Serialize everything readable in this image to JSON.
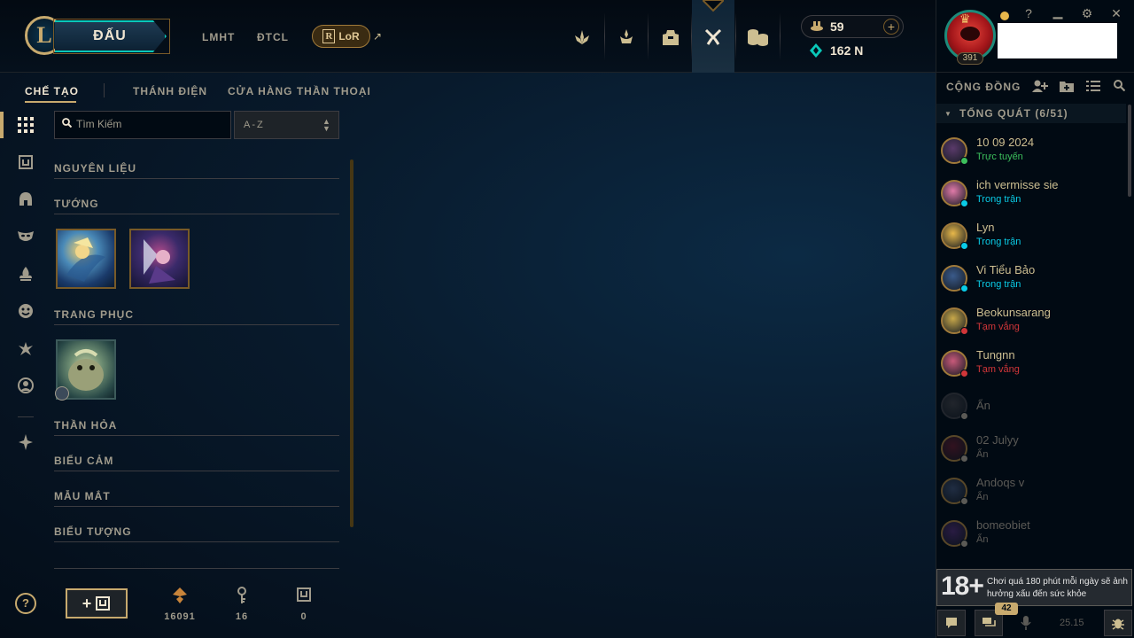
{
  "header": {
    "logo": "L",
    "play_label": "ĐẤU",
    "links": [
      "LMHT",
      "ĐTCL"
    ],
    "lor_label": "LoR",
    "lor_glyph": "R",
    "external_glyph": "↗",
    "nav_icons": [
      "home-icon",
      "tft-icon",
      "collection-icon",
      "loot-icon",
      "store-icon"
    ]
  },
  "currency": {
    "rp": "59",
    "blue_essence": "162 N",
    "add": "+"
  },
  "profile": {
    "level": "391"
  },
  "subnav": {
    "tabs": [
      "CHẾ TẠO",
      "THÁNH ĐIỆN",
      "CỬA HÀNG THẦN THOẠI"
    ]
  },
  "search": {
    "placeholder": "Tìm Kiếm",
    "sort_value": "A-Z"
  },
  "categories": [
    "NGUYÊN LIỆU",
    "TƯỚNG",
    "TRANG PHỤC",
    "THẦN HỎA",
    "BIỂU CẢM",
    "MẪU MẮT",
    "BIỂU TƯỢNG"
  ],
  "resources": [
    {
      "icon": "orange-essence-icon",
      "value": "16091",
      "color": "#c8843a"
    },
    {
      "icon": "key-icon",
      "value": "16",
      "color": "#a09b8c"
    },
    {
      "icon": "chest-icon",
      "value": "0",
      "color": "#a09b8c"
    }
  ],
  "bottom": {
    "help": "?",
    "add_chest_plus": "+"
  },
  "social": {
    "title": "CỘNG ĐỒNG",
    "group": "TỔNG QUÁT (6/51)",
    "friends": [
      {
        "name": "10 09 2024",
        "status": "Trực tuyến",
        "status_color": "#3cbf5c"
      },
      {
        "name": "ich vermisse sie",
        "status": "Trong trận",
        "status_color": "#0acbe6"
      },
      {
        "name": "Lyn",
        "status": "Trong trận",
        "status_color": "#0acbe6"
      },
      {
        "name": "Vi Tiểu Bảo",
        "status": "Trong trận",
        "status_color": "#0acbe6"
      },
      {
        "name": "Beokunsarang",
        "status": "Tạm vắng",
        "status_color": "#d13639"
      },
      {
        "name": "Tungnn",
        "status": "Tạm vắng",
        "status_color": "#d13639"
      },
      {
        "name": "Ẩn",
        "status": "",
        "status_color": "#5b5a56"
      },
      {
        "name": "02 Julyy",
        "status": "Ẩn",
        "status_color": "#5b5a56"
      },
      {
        "name": "Andoqs v",
        "status": "Ẩn",
        "status_color": "#5b5a56"
      },
      {
        "name": "bomeobiet",
        "status": "Ẩn",
        "status_color": "#5b5a56"
      }
    ],
    "age_rating": "18+",
    "age_warning": "Chơi quá 180 phút mỗi ngày sẽ ảnh hưởng xấu đến sức khỏe",
    "chat_badge": "42",
    "patch": "25.15"
  },
  "colors": {
    "gold": "#c8aa6e",
    "teal": "#0ac8b9",
    "bg": "#010a13"
  }
}
